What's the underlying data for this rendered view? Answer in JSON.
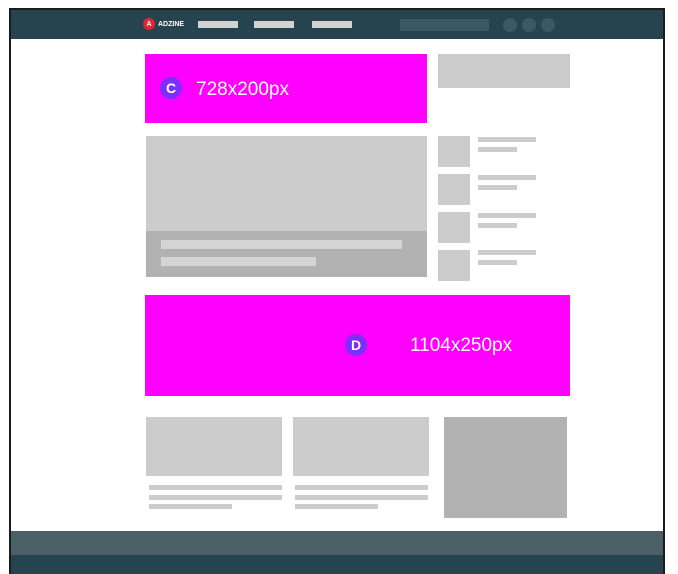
{
  "header": {
    "logo_mark": "A",
    "logo_text": "ADZINE",
    "logo_icon": "adzine-logo-icon",
    "nav_items": 3,
    "action_icons": 3
  },
  "ads": {
    "slot_c": {
      "letter": "C",
      "size_label": "728x200px",
      "color": "#ff00ff"
    },
    "slot_d": {
      "letter": "D",
      "size_label": "1104x250px",
      "color": "#ff00ff"
    }
  },
  "colors": {
    "header_bg": "#26444f",
    "footer_bg": "#4a5f66",
    "ad_fill": "#ff00ff",
    "badge": "#7b2fff",
    "placeholder": "#cccccc"
  }
}
